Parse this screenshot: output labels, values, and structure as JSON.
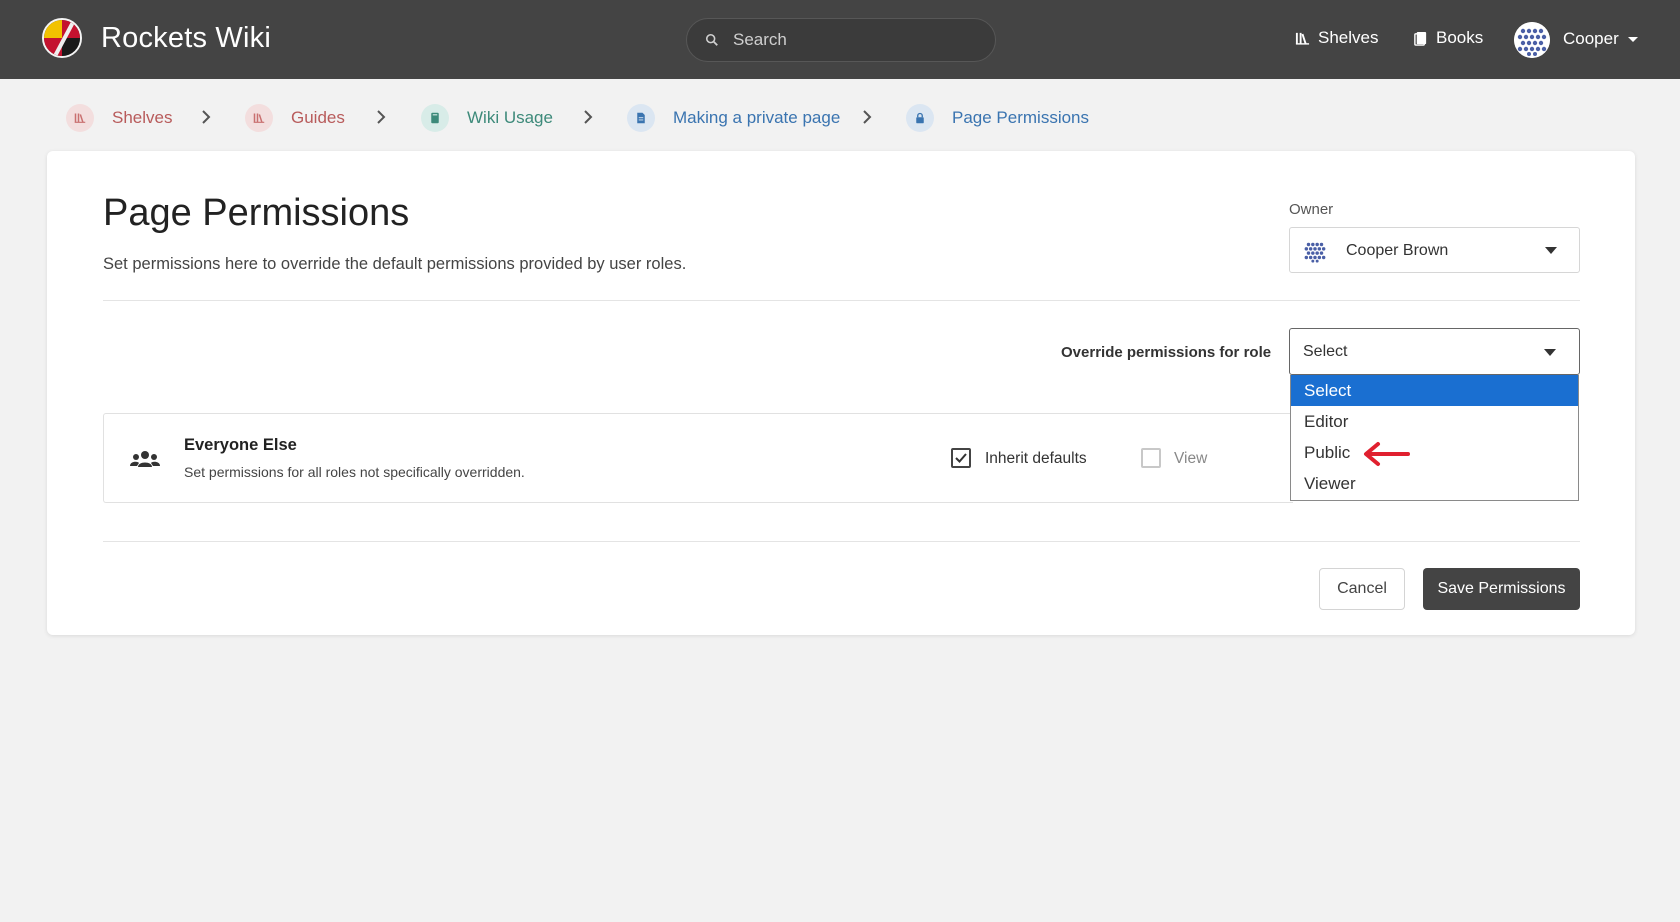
{
  "header": {
    "site_title": "Rockets Wiki",
    "search_placeholder": "Search",
    "nav": [
      {
        "label": "Shelves",
        "icon": "shelves-icon"
      },
      {
        "label": "Books",
        "icon": "books-icon"
      }
    ],
    "user": {
      "name": "Cooper",
      "avatar_icon": "user-avatar-icon"
    }
  },
  "breadcrumb": [
    {
      "label": "Shelves",
      "icon": "shelves-icon",
      "color": "#b85b5b",
      "bg": "#f3dede"
    },
    {
      "label": "Guides",
      "icon": "shelves-icon",
      "color": "#b85b5b",
      "bg": "#f3dede"
    },
    {
      "label": "Wiki Usage",
      "icon": "book-icon",
      "color": "#3d8a7a",
      "bg": "#d8ece8"
    },
    {
      "label": "Making a private page",
      "icon": "page-icon",
      "color": "#3a74b0",
      "bg": "#dbe6f2"
    },
    {
      "label": "Page Permissions",
      "icon": "lock-icon",
      "color": "#3a74b0",
      "bg": "#dbe6f2"
    }
  ],
  "main": {
    "title": "Page Permissions",
    "description": "Set permissions here to override the default permissions provided by user roles.",
    "owner": {
      "label": "Owner",
      "value": "Cooper Brown"
    },
    "override": {
      "label": "Override permissions for role",
      "selected": "Select",
      "options": [
        "Select",
        "Editor",
        "Public",
        "Viewer"
      ],
      "highlighted_option": "Select"
    },
    "everyone_else": {
      "title": "Everyone Else",
      "description": "Set permissions for all roles not specifically overridden.",
      "inherit_label": "Inherit defaults",
      "inherit_checked": true,
      "view_label": "View",
      "view_checked": false
    },
    "actions": {
      "cancel": "Cancel",
      "save": "Save Permissions"
    }
  },
  "annotation": {
    "arrow_color": "#e0202f",
    "points_to": "Public"
  },
  "colors": {
    "header_bg": "#444444",
    "page_bg": "#f2f2f2",
    "selected_option": "#1a6fd1"
  }
}
